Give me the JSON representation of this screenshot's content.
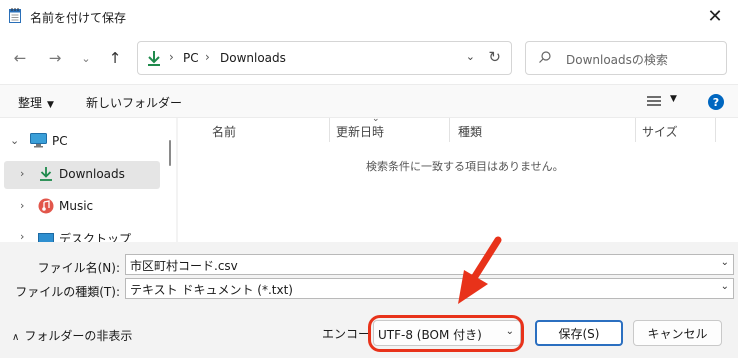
{
  "window": {
    "title": "名前を付けて保存",
    "close_glyph": "✕"
  },
  "nav": {
    "back_glyph": "←",
    "forward_glyph": "→",
    "recent_glyph": "⌄",
    "up_glyph": "↑"
  },
  "address": {
    "crumbs": [
      "PC",
      "Downloads"
    ],
    "separator": "›",
    "dropdown_glyph": "⌄",
    "refresh_glyph": "↻"
  },
  "search": {
    "placeholder": "Downloadsの検索"
  },
  "toolbar": {
    "organize_label": "整理",
    "new_folder_label": "新しいフォルダー",
    "help_glyph": "?",
    "caret_glyph": "▼"
  },
  "sidebar": {
    "items": [
      {
        "label": "PC",
        "icon": "computer-icon",
        "chevron": "⌄",
        "selected": false
      },
      {
        "label": "Downloads",
        "icon": "download-icon",
        "chevron": "›",
        "selected": true
      },
      {
        "label": "Music",
        "icon": "music-icon",
        "chevron": "›",
        "selected": false
      },
      {
        "label": "デスクトップ",
        "icon": "desktop-icon",
        "chevron": "›",
        "selected": false
      }
    ]
  },
  "filelist": {
    "columns": [
      "名前",
      "更新日時",
      "種類",
      "サイズ"
    ],
    "sort_glyph": "⌄",
    "empty_message": "検索条件に一致する項目はありません。"
  },
  "form": {
    "filename_label": "ファイル名(N):",
    "filename_value": "市区町村コード.csv",
    "filetype_label": "ファイルの種類(T):",
    "filetype_value": "テキスト ドキュメント (*.txt)",
    "dropdown_glyph": "⌄"
  },
  "footer": {
    "hide_folders_label": "フォルダーの非表示",
    "hide_caret": "∧",
    "encoding_label": "エンコード:",
    "encoding_value": "UTF-8 (BOM 付き)",
    "save_label": "保存(S)",
    "cancel_label": "キャンセル"
  },
  "colors": {
    "accent": "#0067c0",
    "download_green": "#1f8a4c",
    "highlight_red": "#e8321a",
    "selection": "#e5e5e5"
  }
}
